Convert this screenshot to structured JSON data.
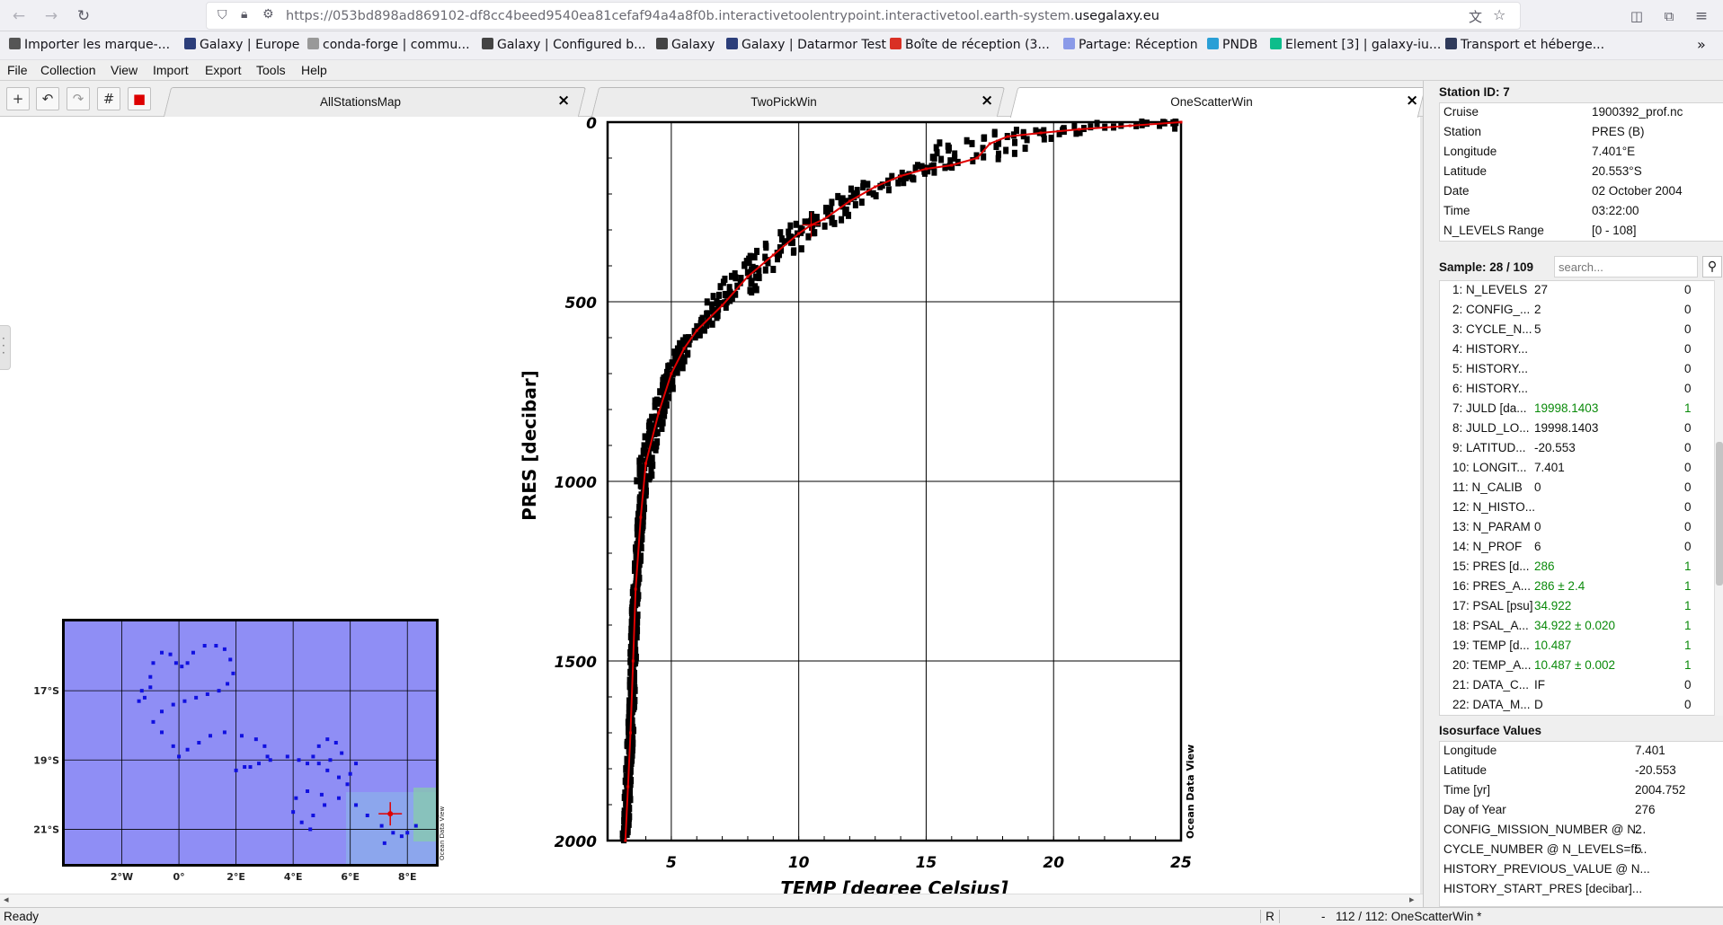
{
  "browser": {
    "url_prefix": "https://053bd898ad869102-df8cc4beed9540ea81cefaf94a4a8f0b.interactivetoolentrypoint.interactivetool.earth-system.",
    "url_domain": "usegalaxy.eu",
    "bookmarks": [
      {
        "label": "Importer les marque-...",
        "color": "#555"
      },
      {
        "label": "Galaxy | Europe",
        "color": "#2c3e7a"
      },
      {
        "label": "conda-forge | commu...",
        "color": "#999"
      },
      {
        "label": "Galaxy | Configured b...",
        "color": "#444"
      },
      {
        "label": "Galaxy",
        "color": "#444"
      },
      {
        "label": "Galaxy | Datarmor Test",
        "color": "#2c3e7a"
      },
      {
        "label": "Boîte de réception (3...",
        "color": "#d93025"
      },
      {
        "label": "Partage: Réception",
        "color": "#8a9ae8"
      },
      {
        "label": "PNDB",
        "color": "#2a9fd6"
      },
      {
        "label": "Element [3] | galaxy-iu...",
        "color": "#0dbd8b"
      },
      {
        "label": "Transport et héberge...",
        "color": "#2f3a5a"
      }
    ]
  },
  "menu": [
    "File",
    "Collection",
    "View",
    "Import",
    "Export",
    "Tools",
    "Help"
  ],
  "tabs": [
    {
      "label": "AllStationsMap"
    },
    {
      "label": "TwoPickWin"
    },
    {
      "label": "OneScatterWin"
    }
  ],
  "station": {
    "title": "Station ID: 7",
    "rows": [
      [
        "Cruise",
        "1900392_prof.nc"
      ],
      [
        "Station",
        "PRES (B)"
      ],
      [
        "Longitude",
        "7.401°E"
      ],
      [
        "Latitude",
        "20.553°S"
      ],
      [
        "Date",
        "02 October 2004"
      ],
      [
        "Time",
        "03:22:00"
      ],
      [
        "N_LEVELS Range",
        "[0 - 108]"
      ]
    ]
  },
  "sample": {
    "title": "Sample: 28 / 109",
    "search_placeholder": "search...",
    "rows": [
      {
        "name": "1: N_LEVELS",
        "value": "27",
        "flag": "0",
        "green": false
      },
      {
        "name": "2: CONFIG_...",
        "value": "2",
        "flag": "0",
        "green": false
      },
      {
        "name": "3: CYCLE_N...",
        "value": "5",
        "flag": "0",
        "green": false
      },
      {
        "name": "4: HISTORY...",
        "value": "",
        "flag": "0",
        "green": false
      },
      {
        "name": "5: HISTORY...",
        "value": "",
        "flag": "0",
        "green": false
      },
      {
        "name": "6: HISTORY...",
        "value": "",
        "flag": "0",
        "green": false
      },
      {
        "name": "7: JULD [da...",
        "value": "19998.1403",
        "flag": "1",
        "green": true
      },
      {
        "name": "8: JULD_LO...",
        "value": "19998.1403",
        "flag": "0",
        "green": false
      },
      {
        "name": "9: LATITUD...",
        "value": "-20.553",
        "flag": "0",
        "green": false
      },
      {
        "name": "10: LONGIT...",
        "value": "7.401",
        "flag": "0",
        "green": false
      },
      {
        "name": "11: N_CALIB",
        "value": "0",
        "flag": "0",
        "green": false
      },
      {
        "name": "12: N_HISTO...",
        "value": "",
        "flag": "0",
        "green": false
      },
      {
        "name": "13: N_PARAM",
        "value": "0",
        "flag": "0",
        "green": false
      },
      {
        "name": "14: N_PROF",
        "value": "6",
        "flag": "0",
        "green": false
      },
      {
        "name": "15: PRES [d...",
        "value": "286",
        "flag": "1",
        "green": true
      },
      {
        "name": "16: PRES_A...",
        "value": "286 ± 2.4",
        "flag": "1",
        "green": true
      },
      {
        "name": "17: PSAL [psu]",
        "value": "34.922",
        "flag": "1",
        "green": true
      },
      {
        "name": "18: PSAL_A...",
        "value": "34.922 ± 0.020",
        "flag": "1",
        "green": true
      },
      {
        "name": "19: TEMP [d...",
        "value": "10.487",
        "flag": "1",
        "green": true
      },
      {
        "name": "20: TEMP_A...",
        "value": "10.487 ± 0.002",
        "flag": "1",
        "green": true
      },
      {
        "name": "21: DATA_C...",
        "value": "IF",
        "flag": "0",
        "green": false
      },
      {
        "name": "22: DATA_M...",
        "value": "D",
        "flag": "0",
        "green": false
      }
    ]
  },
  "isosurface": {
    "title": "Isosurface Values",
    "rows": [
      [
        "Longitude",
        "7.401"
      ],
      [
        "Latitude",
        "-20.553"
      ],
      [
        "Time [yr]",
        "2004.752"
      ],
      [
        "Day of Year",
        "276"
      ],
      [
        "CONFIG_MISSION_NUMBER @ N...",
        "2"
      ],
      [
        "CYCLE_NUMBER @ N_LEVELS=fi...",
        "5"
      ],
      [
        "HISTORY_PREVIOUS_VALUE @ N...",
        ""
      ],
      [
        "HISTORY_START_PRES [decibar]...",
        ""
      ]
    ]
  },
  "status": {
    "left": "Ready",
    "mode": "R",
    "dash": "-",
    "right": "112 / 112: OneScatterWin *"
  },
  "map": {
    "x_ticks": [
      "2°W",
      "0°",
      "2°E",
      "4°E",
      "6°E",
      "8°E"
    ],
    "y_ticks": [
      "17°S",
      "19°S",
      "21°S"
    ],
    "watermark": "Ocean Data View",
    "x_range": [
      -4.0,
      9.0
    ],
    "y_range": [
      -22.0,
      -15.0
    ],
    "selected_station": [
      7.401,
      -20.553
    ]
  },
  "chart_data": {
    "type": "scatter",
    "xlabel": "TEMP [degree Celsius]",
    "ylabel": "PRES [decibar]",
    "watermark": "Ocean Data View",
    "xlim": [
      2.5,
      25
    ],
    "ylim": [
      2000,
      0
    ],
    "x_ticks": [
      5,
      10,
      15,
      20,
      25
    ],
    "y_ticks": [
      0,
      500,
      1000,
      1500,
      2000
    ],
    "grid": true,
    "selected_profile": {
      "x": [
        25.0,
        23.0,
        21.0,
        19.5,
        18.2,
        17.5,
        17.0,
        16.0,
        15.0,
        14.0,
        13.0,
        12.0,
        11.0,
        10.5,
        10.0,
        9.0,
        8.0,
        7.0,
        6.0,
        5.5,
        5.0,
        4.5,
        4.0,
        3.8,
        3.6,
        3.5,
        3.4,
        3.3,
        3.2
      ],
      "y": [
        0,
        10,
        20,
        30,
        40,
        60,
        100,
        120,
        130,
        150,
        180,
        220,
        270,
        286,
        310,
        370,
        430,
        510,
        580,
        630,
        700,
        810,
        950,
        1100,
        1300,
        1500,
        1700,
        1850,
        2000
      ]
    },
    "selected_sample": {
      "x": 10.487,
      "y": 286
    }
  }
}
